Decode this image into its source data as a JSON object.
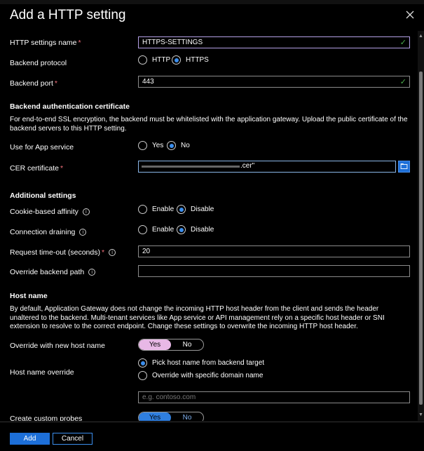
{
  "title": "Add a HTTP setting",
  "fields": {
    "settings_name": {
      "label": "HTTP settings name",
      "value": "HTTPS-SETTINGS"
    },
    "backend_protocol": {
      "label": "Backend protocol",
      "options": [
        "HTTP",
        "HTTPS"
      ],
      "selected": "HTTPS"
    },
    "backend_port": {
      "label": "Backend port",
      "value": "443"
    }
  },
  "backend_auth": {
    "heading": "Backend authentication certificate",
    "description": "For end-to-end SSL encryption, the backend must be whitelisted with the application gateway. Upload the public certificate of the backend servers to this HTTP setting.",
    "app_service": {
      "label": "Use for App service",
      "options": [
        "Yes",
        "No"
      ],
      "selected": "No"
    },
    "cer_certificate": {
      "label": "CER certificate",
      "value_visible": ".cer\""
    }
  },
  "additional": {
    "heading": "Additional settings",
    "cookie_affinity": {
      "label": "Cookie-based affinity",
      "options": [
        "Enable",
        "Disable"
      ],
      "selected": "Disable"
    },
    "connection_draining": {
      "label": "Connection draining",
      "options": [
        "Enable",
        "Disable"
      ],
      "selected": "Disable"
    },
    "request_timeout": {
      "label": "Request time-out (seconds)",
      "value": "20"
    },
    "override_path": {
      "label": "Override backend path",
      "value": ""
    }
  },
  "host_name": {
    "heading": "Host name",
    "description": "By default, Application Gateway does not change the incoming HTTP host header from the client and sends the header unaltered to the backend. Multi-tenant services like App service or API management rely on a specific host header or SNI extension to resolve to the correct endpoint. Change these settings to overwrite the incoming HTTP host header.",
    "override_new_host": {
      "label": "Override with new host name",
      "yes": "Yes",
      "no": "No",
      "selected": "Yes"
    },
    "host_override": {
      "label": "Host name override",
      "options": [
        "Pick host name from backend target",
        "Override with specific domain name"
      ],
      "selected": "Pick host name from backend target",
      "placeholder": "e.g. contoso.com"
    },
    "custom_probes": {
      "label": "Create custom probes",
      "yes": "Yes",
      "no": "No",
      "selected": "Yes"
    }
  },
  "footer": {
    "add_label": "Add",
    "cancel_label": "Cancel"
  },
  "colors": {
    "accent": "#1d6fd8",
    "required": "#f1707b",
    "valid": "#4cae4c",
    "toggle_pink": "#e8b8e6"
  },
  "icons": [
    "close-icon",
    "checkmark-icon",
    "folder-icon",
    "info-icon"
  ]
}
